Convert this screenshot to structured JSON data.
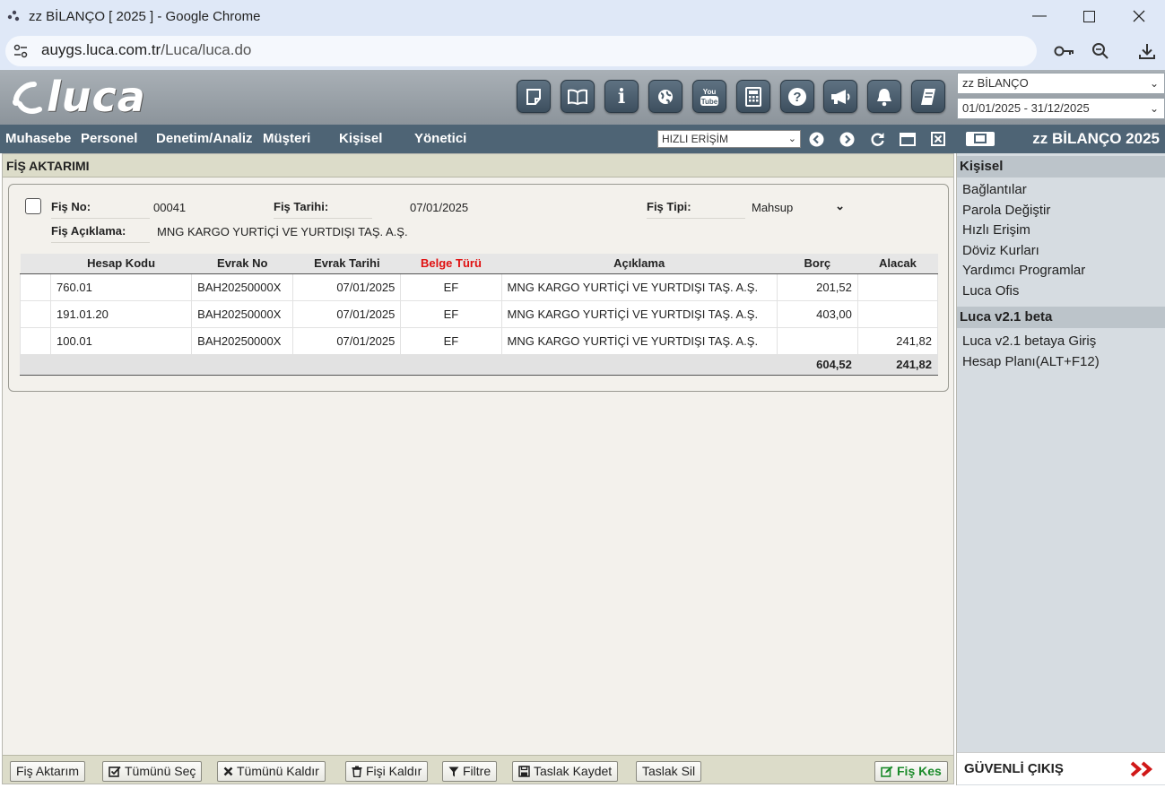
{
  "window": {
    "title": "zz BİLANÇO [ 2025 ] - Google Chrome",
    "url_host": "auygs.luca.com.tr",
    "url_path": "/Luca/luca.do"
  },
  "header": {
    "logo_text": "luca",
    "company_select": "zz BİLANÇO",
    "period_select": "01/01/2025 - 31/12/2025"
  },
  "nav": {
    "items": [
      "Muhasebe",
      "Personel",
      "Denetim/Analiz",
      "Müşteri",
      "Kişisel",
      "Yönetici"
    ],
    "quick_access": "HIZLI ERİŞİM",
    "company": "zz BİLANÇO 2025"
  },
  "panel": {
    "title": "FİŞ AKTARIMI",
    "fis_no_label": "Fiş No:",
    "fis_no": "00041",
    "fis_tarihi_label": "Fiş Tarihi:",
    "fis_tarihi": "07/01/2025",
    "fis_tipi_label": "Fiş Tipi:",
    "fis_tipi": "Mahsup",
    "aciklama_label": "Fiş Açıklama:",
    "aciklama": "MNG KARGO YURTİÇİ VE YURTDIŞI TAŞ. A.Ş."
  },
  "table": {
    "columns": [
      "",
      "Hesap Kodu",
      "Evrak No",
      "Evrak Tarihi",
      "Belge Türü",
      "Açıklama",
      "Borç",
      "Alacak"
    ],
    "rows": [
      {
        "hesap": "760.01",
        "evrak_no": "BAH20250000X",
        "tarih": "07/01/2025",
        "belge": "EF",
        "aciklama": "MNG KARGO YURTİÇİ VE YURTDIŞI TAŞ. A.Ş.",
        "borc": "201,52",
        "alacak": ""
      },
      {
        "hesap": "191.01.20",
        "evrak_no": "BAH20250000X",
        "tarih": "07/01/2025",
        "belge": "EF",
        "aciklama": "MNG KARGO YURTİÇİ VE YURTDIŞI TAŞ. A.Ş.",
        "borc": "403,00",
        "alacak": ""
      },
      {
        "hesap": "100.01",
        "evrak_no": "BAH20250000X",
        "tarih": "07/01/2025",
        "belge": "EF",
        "aciklama": "MNG KARGO YURTİÇİ VE YURTDIŞI TAŞ. A.Ş.",
        "borc": "",
        "alacak": "241,82"
      }
    ],
    "total_borc": "604,52",
    "total_alacak": "241,82"
  },
  "buttons": {
    "fis_aktarim": "Fiş Aktarım",
    "tumunu_sec": "Tümünü Seç",
    "tumunu_kaldir": "Tümünü Kaldır",
    "fisi_kaldir": "Fişi Kaldır",
    "filtre": "Filtre",
    "taslak_kaydet": "Taslak Kaydet",
    "taslak_sil": "Taslak Sil",
    "fis_kes": "Fiş Kes"
  },
  "sidebar": {
    "section1": "Kişisel",
    "items1": [
      "Bağlantılar",
      "Parola Değiştir",
      "Hızlı Erişim",
      "Döviz Kurları",
      "Yardımcı Programlar",
      "Luca Ofis"
    ],
    "section2": "Luca v2.1 beta",
    "items2": [
      "Luca v2.1 betaya Giriş",
      "Hesap Planı(ALT+F12)"
    ],
    "logout": "GÜVENLİ ÇIKIŞ"
  },
  "colors": {
    "navbar": "#4e6475",
    "belge_turu_header": "#e01010",
    "fis_kes": "#1a8a2a",
    "logout_arrows": "#d01818"
  }
}
